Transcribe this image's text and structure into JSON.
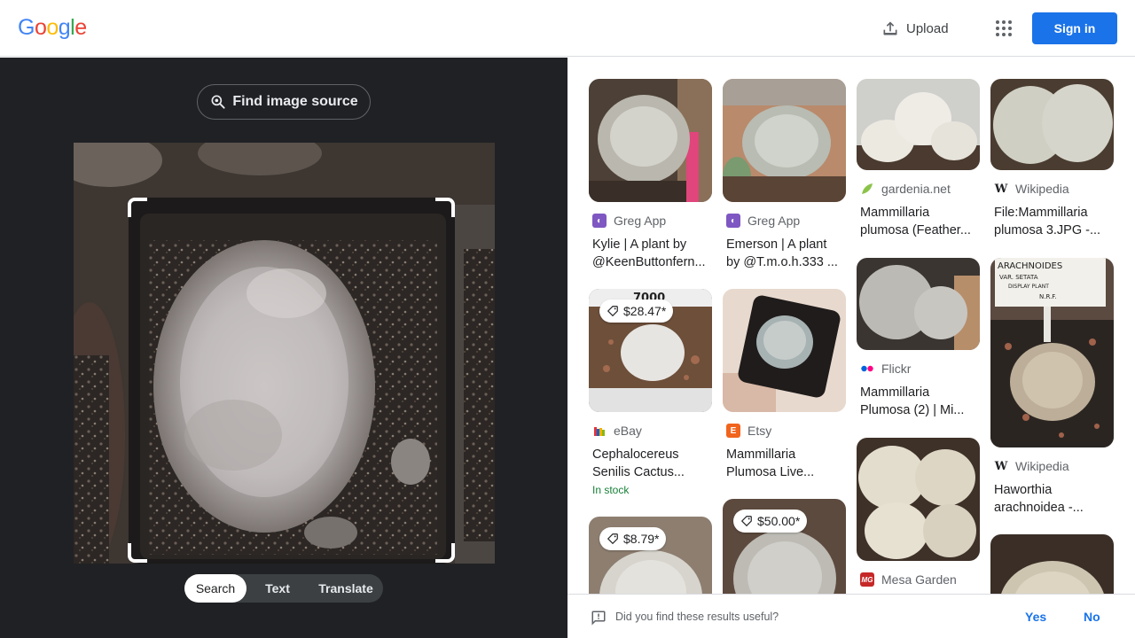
{
  "header": {
    "logo": [
      "G",
      "o",
      "o",
      "g",
      "l",
      "e"
    ],
    "logo_colors": [
      "#4285f4",
      "#ea4335",
      "#fbbc05",
      "#4285f4",
      "#34a853",
      "#ea4335"
    ],
    "upload_label": "Upload",
    "apps_icon": "apps-grid-icon",
    "signin_label": "Sign in",
    "accent": "#1a73e8"
  },
  "lens": {
    "find_source_label": "Find image source",
    "modes": [
      "Search",
      "Text",
      "Translate"
    ],
    "active_mode": "Search"
  },
  "results": [
    {
      "source": "Greg App",
      "favicon_color": "#7e57c2",
      "favicon_glyph": "◐",
      "title_lines": [
        "Kylie | A plant by",
        "@KeenButtonfern..."
      ]
    },
    {
      "source": "Greg App",
      "favicon_color": "#7e57c2",
      "favicon_glyph": "◐",
      "title_lines": [
        "Emerson | A plant",
        "by @T.m.o.h.333 ..."
      ]
    },
    {
      "source": "gardenia.net",
      "favicon_color": "#8bc34a",
      "favicon_glyph": "◢",
      "title_lines": [
        "Mammillaria",
        "plumosa (Feather..."
      ]
    },
    {
      "source": "Wikipedia",
      "favicon_color": "#ffffff",
      "favicon_glyph": "W",
      "title_lines": [
        "File:Mammillaria",
        "plumosa 3.JPG -..."
      ]
    },
    {
      "source": "eBay",
      "price": "$28.47*",
      "favicon_color": "#ffffff",
      "favicon_glyph": "▮",
      "title_lines": [
        "Cephalocereus",
        "Senilis Cactus..."
      ],
      "stock": "In stock"
    },
    {
      "source": "Etsy",
      "favicon_color": "#f1641e",
      "favicon_glyph": "E",
      "title_lines": [
        "Mammillaria",
        "Plumosa Live..."
      ]
    },
    {
      "source": "Flickr",
      "favicon_color": "#ffffff",
      "favicon_glyph": "••",
      "title_lines": [
        "Mammillaria",
        "Plumosa (2) | Mi..."
      ]
    },
    {
      "source": "Wikipedia",
      "favicon_color": "#ffffff",
      "favicon_glyph": "W",
      "title_lines": [
        "Haworthia",
        "arachnoidea -..."
      ]
    },
    {
      "price": "$8.79*"
    },
    {
      "price": "$50.00*"
    },
    {
      "source": "Mesa Garden",
      "favicon_color": "#c62828",
      "favicon_glyph": "MG"
    },
    {}
  ],
  "thumb_labels": {
    "card_4": "7000",
    "card_8": [
      "ARACHNOIDES",
      "VAR. SETATA",
      "DISPLAY PLANT",
      "N.R.F."
    ]
  },
  "feedback": {
    "question": "Did you find these results useful?",
    "yes_label": "Yes",
    "no_label": "No"
  }
}
